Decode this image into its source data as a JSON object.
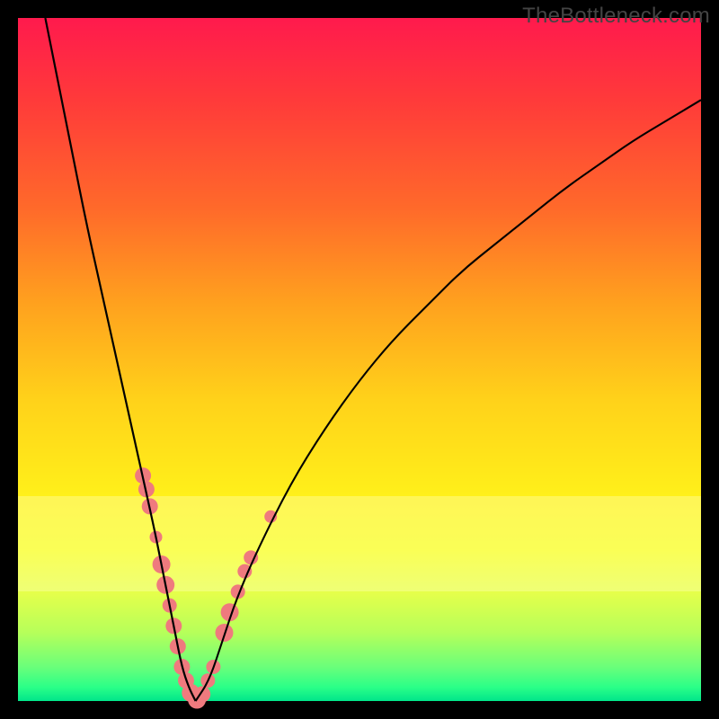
{
  "watermark": "TheBottleneck.com",
  "chart_data": {
    "type": "line",
    "title": "",
    "xlabel": "",
    "ylabel": "",
    "xlim": [
      0,
      100
    ],
    "ylim": [
      0,
      100
    ],
    "series": [
      {
        "name": "bottleneck-curve",
        "x": [
          4,
          6,
          8,
          10,
          12,
          14,
          16,
          18,
          20,
          21,
          22,
          23,
          24,
          25,
          26,
          28,
          30,
          32,
          35,
          40,
          45,
          50,
          55,
          60,
          65,
          70,
          75,
          80,
          85,
          90,
          95,
          100
        ],
        "values": [
          100,
          90,
          80,
          70,
          61,
          52,
          43,
          34,
          25,
          20,
          15,
          10,
          5,
          2,
          0,
          3,
          9,
          15,
          22,
          32,
          40,
          47,
          53,
          58,
          63,
          67,
          71,
          75,
          78.5,
          82,
          85,
          88
        ]
      }
    ],
    "markers": {
      "name": "highlighted-points",
      "color": "#ef7a7e",
      "points": [
        {
          "x": 18.3,
          "y": 33,
          "r": 9
        },
        {
          "x": 18.8,
          "y": 31,
          "r": 9
        },
        {
          "x": 19.3,
          "y": 28.5,
          "r": 9
        },
        {
          "x": 20.2,
          "y": 24,
          "r": 7
        },
        {
          "x": 21.0,
          "y": 20,
          "r": 10
        },
        {
          "x": 21.6,
          "y": 17,
          "r": 10
        },
        {
          "x": 22.2,
          "y": 14,
          "r": 8
        },
        {
          "x": 22.8,
          "y": 11,
          "r": 9
        },
        {
          "x": 23.4,
          "y": 8,
          "r": 9
        },
        {
          "x": 24.0,
          "y": 5,
          "r": 9
        },
        {
          "x": 24.6,
          "y": 3,
          "r": 9
        },
        {
          "x": 25.3,
          "y": 1.2,
          "r": 10
        },
        {
          "x": 26.2,
          "y": 0.2,
          "r": 10
        },
        {
          "x": 27.0,
          "y": 1,
          "r": 9
        },
        {
          "x": 27.8,
          "y": 3,
          "r": 8
        },
        {
          "x": 28.6,
          "y": 5,
          "r": 8
        },
        {
          "x": 30.2,
          "y": 10,
          "r": 10
        },
        {
          "x": 31.0,
          "y": 13,
          "r": 10
        },
        {
          "x": 32.2,
          "y": 16,
          "r": 8
        },
        {
          "x": 33.2,
          "y": 19,
          "r": 8
        },
        {
          "x": 34.1,
          "y": 21,
          "r": 8
        },
        {
          "x": 37.0,
          "y": 27,
          "r": 7
        }
      ]
    },
    "background_gradient": [
      "#ff1a4d",
      "#ffa21e",
      "#fff01a",
      "#00e58a"
    ]
  }
}
